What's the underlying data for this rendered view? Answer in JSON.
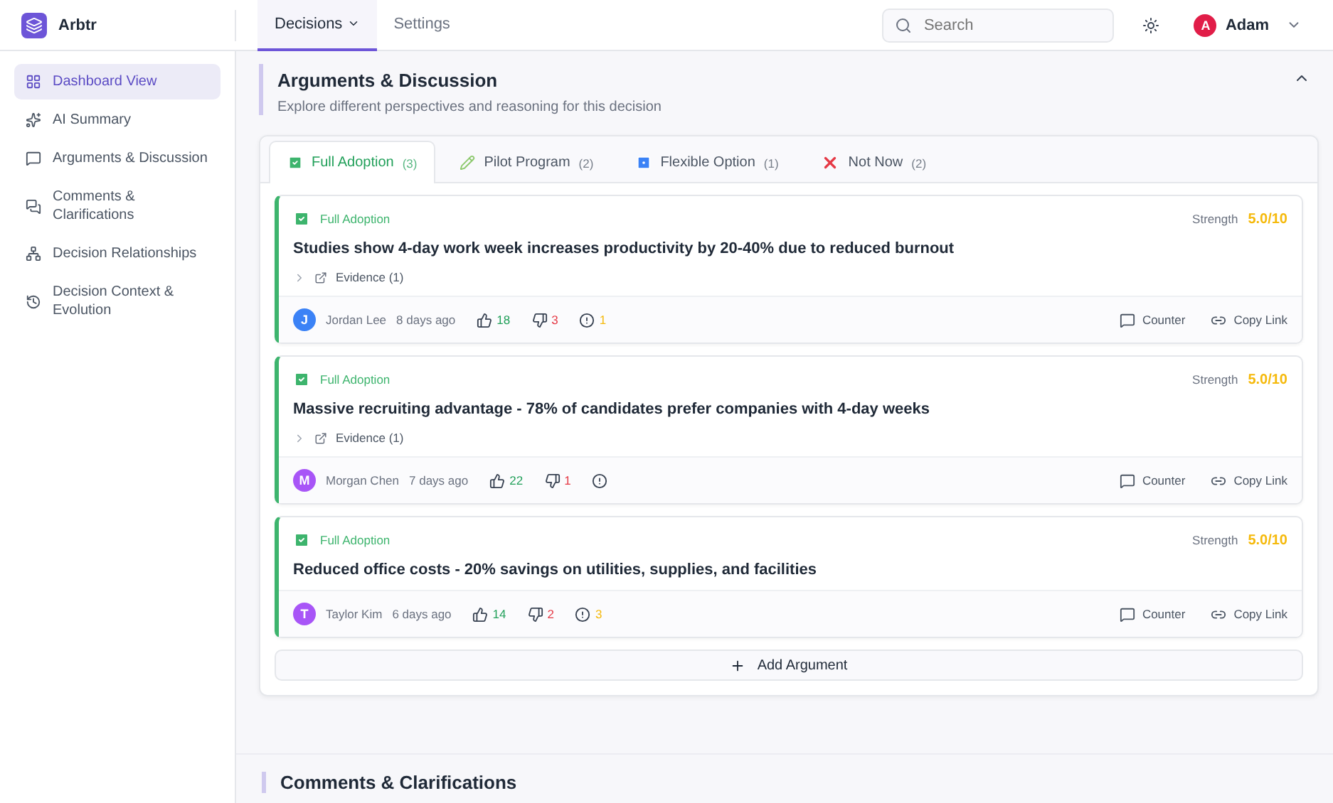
{
  "app": {
    "name": "Arbtr"
  },
  "nav": [
    {
      "label": "Decisions",
      "selected": true,
      "dropdown": true
    },
    {
      "label": "Settings",
      "selected": false,
      "dropdown": false
    }
  ],
  "search": {
    "placeholder": "Search"
  },
  "user": {
    "initial": "A",
    "name": "Adam"
  },
  "sidebar": {
    "items": [
      {
        "label": "Dashboard View",
        "selected": true
      },
      {
        "label": "AI Summary",
        "selected": false
      },
      {
        "label": "Arguments & Discussion",
        "selected": false
      },
      {
        "label": "Comments & Clarifications",
        "selected": false
      },
      {
        "label": "Decision Relationships",
        "selected": false
      },
      {
        "label": "Decision Context & Evolution",
        "selected": false
      }
    ]
  },
  "section": {
    "title": "Arguments & Discussion",
    "subtitle": "Explore different perspectives and reasoning for this decision",
    "expanded": true
  },
  "tabs": [
    {
      "label": "Full Adoption",
      "count": "(3)",
      "kind": "check",
      "selected": true
    },
    {
      "label": "Pilot Program",
      "count": "(2)",
      "kind": "pencil",
      "selected": false
    },
    {
      "label": "Flexible Option",
      "count": "(1)",
      "kind": "box",
      "selected": false
    },
    {
      "label": "Not Now",
      "count": "(2)",
      "kind": "cross",
      "selected": false
    }
  ],
  "arguments": [
    {
      "option": "Full Adoption",
      "strength_label": "Strength",
      "strength": "5.0/10",
      "title": "Studies show 4-day work week increases productivity by 20-40% due to reduced burnout",
      "evidence": "Evidence (1)",
      "author_initial": "J",
      "author": "Jordan Lee",
      "color": "#3b82f6",
      "time": "8 days ago",
      "upvotes": "18",
      "downvotes": "3",
      "flags": "1",
      "counter": "Counter",
      "copy": "Copy Link"
    },
    {
      "option": "Full Adoption",
      "strength_label": "Strength",
      "strength": "5.0/10",
      "title": "Massive recruiting advantage - 78% of candidates prefer companies with 4-day weeks",
      "evidence": "Evidence (1)",
      "author_initial": "M",
      "author": "Morgan Chen",
      "color": "#a855f7",
      "time": "7 days ago",
      "upvotes": "22",
      "downvotes": "1",
      "counter": "Counter",
      "copy": "Copy Link"
    },
    {
      "option": "Full Adoption",
      "strength_label": "Strength",
      "strength": "5.0/10",
      "title": "Reduced office costs - 20% savings on utilities, supplies, and facilities",
      "author_initial": "T",
      "author": "Taylor Kim",
      "color": "#a855f7",
      "time": "6 days ago",
      "upvotes": "14",
      "downvotes": "2",
      "flags": "3",
      "counter": "Counter",
      "copy": "Copy Link"
    }
  ],
  "add_button": "Add Argument",
  "next_section": {
    "title": "Comments & Clarifications"
  }
}
